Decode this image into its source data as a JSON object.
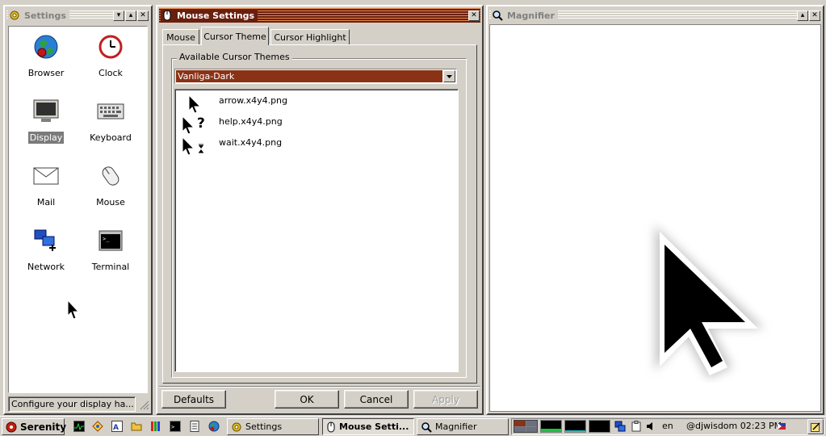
{
  "settings_window": {
    "title": "Settings",
    "apps": [
      {
        "label": "Browser",
        "icon": "globe-icon"
      },
      {
        "label": "Clock",
        "icon": "clock-icon"
      },
      {
        "label": "Display",
        "icon": "monitor-icon",
        "selected": true
      },
      {
        "label": "Keyboard",
        "icon": "keyboard-icon"
      },
      {
        "label": "Mail",
        "icon": "envelope-icon"
      },
      {
        "label": "Mouse",
        "icon": "mouse-icon"
      },
      {
        "label": "Network",
        "icon": "network-icon"
      },
      {
        "label": "Terminal",
        "icon": "terminal-icon"
      }
    ],
    "status_text": "Configure your display ha..."
  },
  "mouse_window": {
    "title": "Mouse Settings",
    "tabs": [
      {
        "label": "Mouse"
      },
      {
        "label": "Cursor Theme",
        "active": true
      },
      {
        "label": "Cursor Highlight"
      }
    ],
    "group_label": "Available Cursor Themes",
    "selected_theme": "Vanliga-Dark",
    "cursor_files": [
      {
        "name": "arrow.x4y4.png",
        "icon": "arrow-cursor-icon"
      },
      {
        "name": "help.x4y4.png",
        "icon": "help-cursor-icon"
      },
      {
        "name": "wait.x4y4.png",
        "icon": "wait-cursor-icon"
      }
    ],
    "buttons": {
      "defaults": "Defaults",
      "ok": "OK",
      "cancel": "Cancel",
      "apply": "Apply"
    }
  },
  "magnifier_window": {
    "title": "Magnifier"
  },
  "taskbar": {
    "start_label": "Serenity",
    "tasks": [
      {
        "label": "Settings",
        "icon": "gear-icon"
      },
      {
        "label": "Mouse Setti...",
        "icon": "mouse-icon",
        "active": true
      },
      {
        "label": "Magnifier",
        "icon": "magnifier-icon"
      }
    ],
    "keyboard_layout": "en",
    "clock_text": "@djwisdom 02:23 PM"
  },
  "colors": {
    "active_title": "#6a1f0e",
    "selection": "#8a3216",
    "face": "#d4d0c8"
  }
}
